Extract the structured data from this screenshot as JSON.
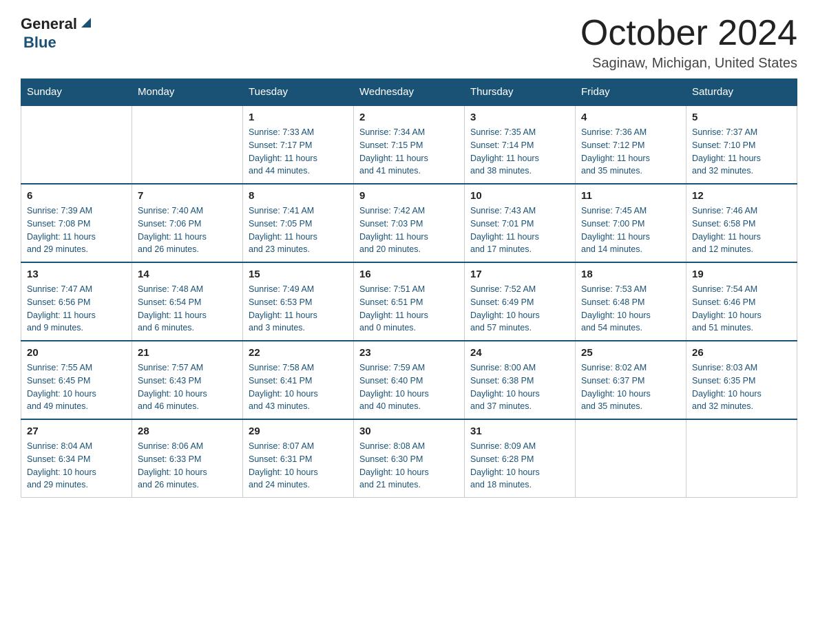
{
  "header": {
    "logo_general": "General",
    "logo_blue": "Blue",
    "month_title": "October 2024",
    "location": "Saginaw, Michigan, United States"
  },
  "days_of_week": [
    "Sunday",
    "Monday",
    "Tuesday",
    "Wednesday",
    "Thursday",
    "Friday",
    "Saturday"
  ],
  "weeks": [
    [
      {
        "day": "",
        "info": ""
      },
      {
        "day": "",
        "info": ""
      },
      {
        "day": "1",
        "info": "Sunrise: 7:33 AM\nSunset: 7:17 PM\nDaylight: 11 hours\nand 44 minutes."
      },
      {
        "day": "2",
        "info": "Sunrise: 7:34 AM\nSunset: 7:15 PM\nDaylight: 11 hours\nand 41 minutes."
      },
      {
        "day": "3",
        "info": "Sunrise: 7:35 AM\nSunset: 7:14 PM\nDaylight: 11 hours\nand 38 minutes."
      },
      {
        "day": "4",
        "info": "Sunrise: 7:36 AM\nSunset: 7:12 PM\nDaylight: 11 hours\nand 35 minutes."
      },
      {
        "day": "5",
        "info": "Sunrise: 7:37 AM\nSunset: 7:10 PM\nDaylight: 11 hours\nand 32 minutes."
      }
    ],
    [
      {
        "day": "6",
        "info": "Sunrise: 7:39 AM\nSunset: 7:08 PM\nDaylight: 11 hours\nand 29 minutes."
      },
      {
        "day": "7",
        "info": "Sunrise: 7:40 AM\nSunset: 7:06 PM\nDaylight: 11 hours\nand 26 minutes."
      },
      {
        "day": "8",
        "info": "Sunrise: 7:41 AM\nSunset: 7:05 PM\nDaylight: 11 hours\nand 23 minutes."
      },
      {
        "day": "9",
        "info": "Sunrise: 7:42 AM\nSunset: 7:03 PM\nDaylight: 11 hours\nand 20 minutes."
      },
      {
        "day": "10",
        "info": "Sunrise: 7:43 AM\nSunset: 7:01 PM\nDaylight: 11 hours\nand 17 minutes."
      },
      {
        "day": "11",
        "info": "Sunrise: 7:45 AM\nSunset: 7:00 PM\nDaylight: 11 hours\nand 14 minutes."
      },
      {
        "day": "12",
        "info": "Sunrise: 7:46 AM\nSunset: 6:58 PM\nDaylight: 11 hours\nand 12 minutes."
      }
    ],
    [
      {
        "day": "13",
        "info": "Sunrise: 7:47 AM\nSunset: 6:56 PM\nDaylight: 11 hours\nand 9 minutes."
      },
      {
        "day": "14",
        "info": "Sunrise: 7:48 AM\nSunset: 6:54 PM\nDaylight: 11 hours\nand 6 minutes."
      },
      {
        "day": "15",
        "info": "Sunrise: 7:49 AM\nSunset: 6:53 PM\nDaylight: 11 hours\nand 3 minutes."
      },
      {
        "day": "16",
        "info": "Sunrise: 7:51 AM\nSunset: 6:51 PM\nDaylight: 11 hours\nand 0 minutes."
      },
      {
        "day": "17",
        "info": "Sunrise: 7:52 AM\nSunset: 6:49 PM\nDaylight: 10 hours\nand 57 minutes."
      },
      {
        "day": "18",
        "info": "Sunrise: 7:53 AM\nSunset: 6:48 PM\nDaylight: 10 hours\nand 54 minutes."
      },
      {
        "day": "19",
        "info": "Sunrise: 7:54 AM\nSunset: 6:46 PM\nDaylight: 10 hours\nand 51 minutes."
      }
    ],
    [
      {
        "day": "20",
        "info": "Sunrise: 7:55 AM\nSunset: 6:45 PM\nDaylight: 10 hours\nand 49 minutes."
      },
      {
        "day": "21",
        "info": "Sunrise: 7:57 AM\nSunset: 6:43 PM\nDaylight: 10 hours\nand 46 minutes."
      },
      {
        "day": "22",
        "info": "Sunrise: 7:58 AM\nSunset: 6:41 PM\nDaylight: 10 hours\nand 43 minutes."
      },
      {
        "day": "23",
        "info": "Sunrise: 7:59 AM\nSunset: 6:40 PM\nDaylight: 10 hours\nand 40 minutes."
      },
      {
        "day": "24",
        "info": "Sunrise: 8:00 AM\nSunset: 6:38 PM\nDaylight: 10 hours\nand 37 minutes."
      },
      {
        "day": "25",
        "info": "Sunrise: 8:02 AM\nSunset: 6:37 PM\nDaylight: 10 hours\nand 35 minutes."
      },
      {
        "day": "26",
        "info": "Sunrise: 8:03 AM\nSunset: 6:35 PM\nDaylight: 10 hours\nand 32 minutes."
      }
    ],
    [
      {
        "day": "27",
        "info": "Sunrise: 8:04 AM\nSunset: 6:34 PM\nDaylight: 10 hours\nand 29 minutes."
      },
      {
        "day": "28",
        "info": "Sunrise: 8:06 AM\nSunset: 6:33 PM\nDaylight: 10 hours\nand 26 minutes."
      },
      {
        "day": "29",
        "info": "Sunrise: 8:07 AM\nSunset: 6:31 PM\nDaylight: 10 hours\nand 24 minutes."
      },
      {
        "day": "30",
        "info": "Sunrise: 8:08 AM\nSunset: 6:30 PM\nDaylight: 10 hours\nand 21 minutes."
      },
      {
        "day": "31",
        "info": "Sunrise: 8:09 AM\nSunset: 6:28 PM\nDaylight: 10 hours\nand 18 minutes."
      },
      {
        "day": "",
        "info": ""
      },
      {
        "day": "",
        "info": ""
      }
    ]
  ]
}
